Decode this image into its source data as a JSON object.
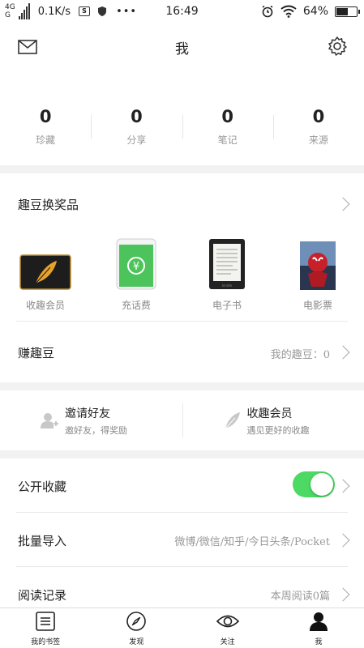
{
  "status_bar": {
    "signal_top": "4G",
    "signal_bottom": "G",
    "speed": "0.1K/s",
    "time": "16:49",
    "battery": "64%",
    "battery_level": 0.64
  },
  "header": {
    "title": "我"
  },
  "stats": [
    {
      "value": "0",
      "label": "珍藏"
    },
    {
      "value": "0",
      "label": "分享"
    },
    {
      "value": "0",
      "label": "笔记"
    },
    {
      "value": "0",
      "label": "来源"
    }
  ],
  "exchange": {
    "title": "趣豆换奖品",
    "products": [
      {
        "label": "收趣会员",
        "icon": "membership-card-icon"
      },
      {
        "label": "充话费",
        "icon": "phone-credit-icon"
      },
      {
        "label": "电子书",
        "icon": "ereader-icon"
      },
      {
        "label": "电影票",
        "icon": "movie-poster-icon"
      }
    ],
    "earn_label": "赚趣豆",
    "earn_value": "我的趣豆：0"
  },
  "invite": [
    {
      "title": "邀请好友",
      "sub": "邀好友，得奖励",
      "icon": "add-user-icon"
    },
    {
      "title": "收趣会员",
      "sub": "遇见更好的收趣",
      "icon": "feather-icon"
    }
  ],
  "settings": {
    "public_label": "公开收藏",
    "public_on": true,
    "import_label": "批量导入",
    "import_value": "微博/微信/知乎/今日头条/Pocket",
    "history_label": "阅读记录",
    "history_value": "本周阅读0篇"
  },
  "tabs": [
    {
      "label": "我的书签",
      "icon": "bookmarks-icon"
    },
    {
      "label": "发现",
      "icon": "compass-icon"
    },
    {
      "label": "关注",
      "icon": "eye-icon"
    },
    {
      "label": "我",
      "icon": "user-icon"
    }
  ],
  "colors": {
    "toggle_on": "#4cd964",
    "accent_orange": "#e8a22b",
    "wechat_green": "#4cc35b"
  }
}
